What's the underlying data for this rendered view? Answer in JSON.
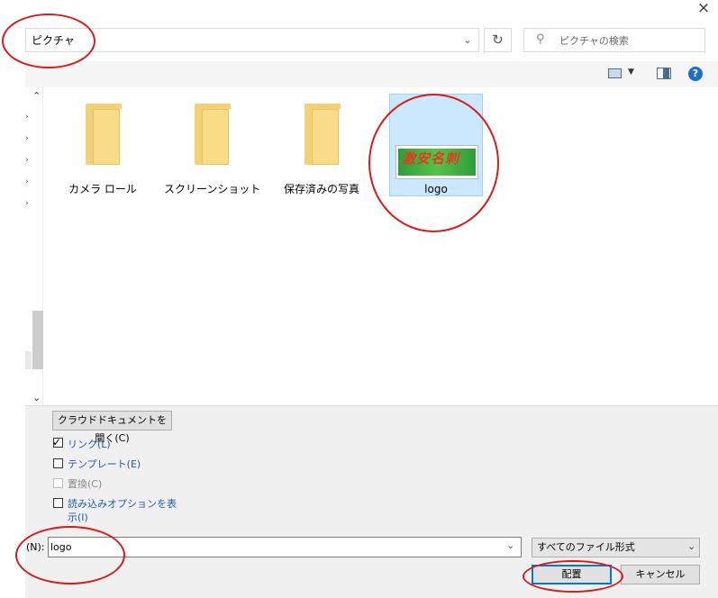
{
  "window": {
    "close_label": "×"
  },
  "address": {
    "path": "ピクチャ",
    "dropdown_icon": "chevron-down-icon",
    "refresh_icon": "refresh-icon"
  },
  "search": {
    "placeholder": "ピクチャの検索"
  },
  "toolbar": {
    "view_icon": "view-icon",
    "pane_icon": "preview-pane-icon",
    "help_label": "?"
  },
  "nav": {
    "scroll_up": "^",
    "scroll_down": "v"
  },
  "items": [
    {
      "label": "カメラ ロール",
      "type": "folder"
    },
    {
      "label": "スクリーンショット",
      "type": "folder"
    },
    {
      "label": "保存済みの写真",
      "type": "folder"
    },
    {
      "label": "logo",
      "type": "image",
      "selected": true
    }
  ],
  "logo_thumbnail_text": "激安名刺",
  "options": {
    "cloud_button": "クラウドドキュメントを開く(C)",
    "link": {
      "label": "リンク(L)",
      "checked": true
    },
    "template": {
      "label": "テンプレート(E)",
      "checked": false
    },
    "replace": {
      "label": "置換(C)",
      "checked": false,
      "disabled": true
    },
    "import_options": {
      "label_line1": "読み込みオプションを表",
      "label_line2": "示(I)",
      "checked": false
    }
  },
  "filename": {
    "label": "(N):",
    "value": "logo"
  },
  "filetype": {
    "selected": "すべてのファイル形式"
  },
  "buttons": {
    "place": "配置",
    "cancel": "キャンセル"
  },
  "colors": {
    "selection_bg": "#cce8ff",
    "annotation_red": "#d81b1b",
    "accent": "#0078d7"
  }
}
